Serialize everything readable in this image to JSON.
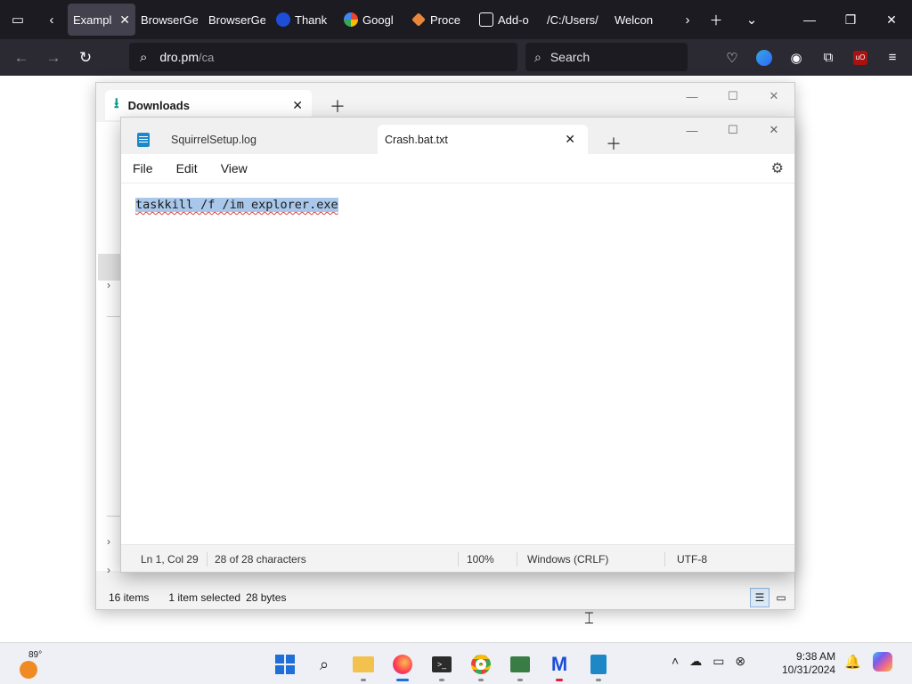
{
  "browser": {
    "tabs": [
      {
        "label": "Exampl",
        "active": true
      },
      {
        "label": "BrowserGe",
        "active": false
      },
      {
        "label": "BrowserGe",
        "active": false
      },
      {
        "label": "Thank",
        "active": false
      },
      {
        "label": "Googl",
        "active": false
      },
      {
        "label": "Proce",
        "active": false
      },
      {
        "label": "Add-o",
        "active": false
      },
      {
        "label": "/C:/Users/",
        "active": false
      },
      {
        "label": "Welcon",
        "active": false
      }
    ],
    "url_main": "dro.pm",
    "url_rest": "/ca",
    "search_placeholder": "Search"
  },
  "explorer": {
    "tab_title": "Downloads",
    "status_items": "16 items",
    "status_selected": "1 item selected",
    "status_size": "28 bytes"
  },
  "notepad": {
    "tabs": [
      "SquirrelSetup.log",
      "Crash.bat.txt"
    ],
    "menu": [
      "File",
      "Edit",
      "View"
    ],
    "content": "taskkill /f /im explorer.exe",
    "status": {
      "position": "Ln 1, Col 29",
      "chars": "28 of 28 characters",
      "zoom": "100%",
      "line_ending": "Windows (CRLF)",
      "encoding": "UTF-8"
    }
  },
  "taskbar": {
    "temperature": "89°",
    "time": "9:38 AM",
    "date": "10/31/2024"
  }
}
